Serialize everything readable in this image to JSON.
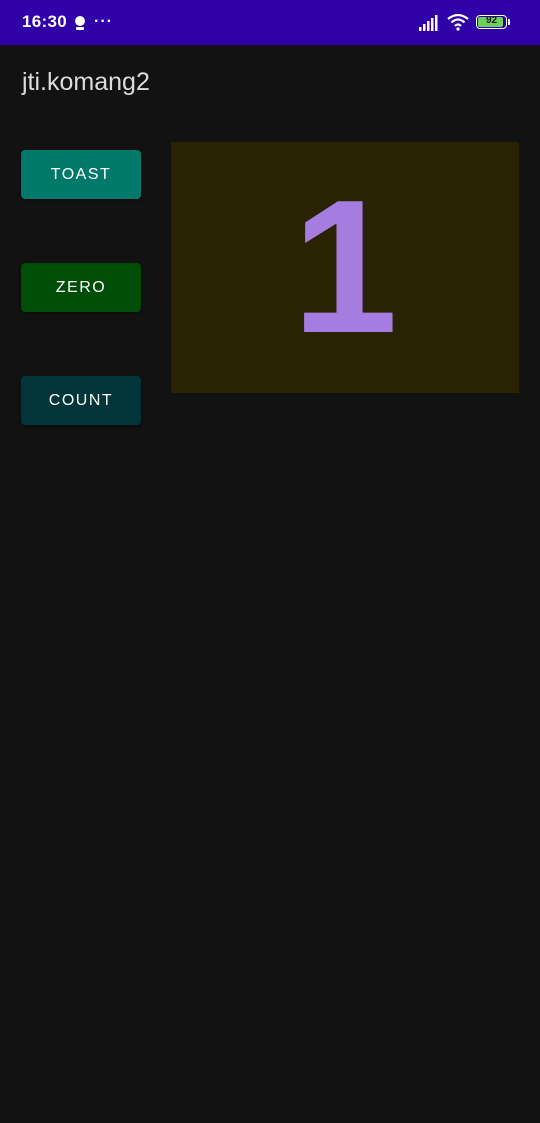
{
  "status_bar": {
    "time": "16:30",
    "more": "···",
    "battery_level": "92",
    "battery_fraction": 0.92,
    "background": "#3000a8"
  },
  "app": {
    "title": "jti.komang2"
  },
  "buttons": {
    "toast_label": "TOAST",
    "zero_label": "ZERO",
    "count_label": "COUNT"
  },
  "counter": {
    "value": "1",
    "color": "#a57de0",
    "background": "#292304"
  },
  "colors": {
    "toast": "#00796b",
    "zero": "#004d08",
    "count": "#01353a",
    "page": "#121212"
  }
}
